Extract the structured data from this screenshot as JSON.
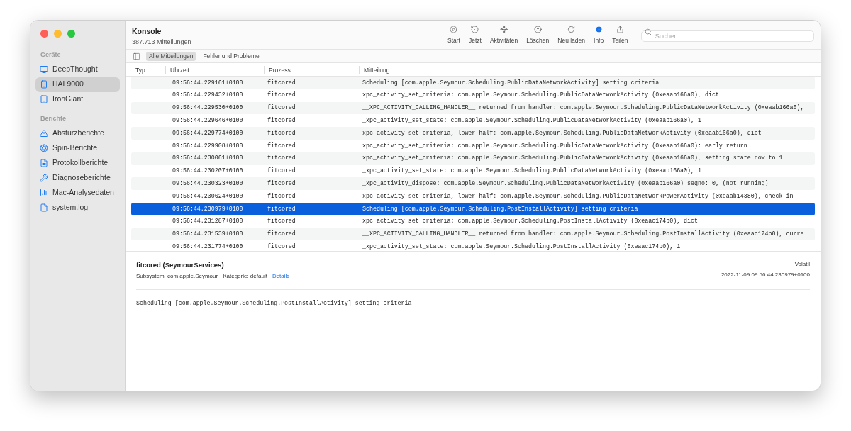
{
  "window": {
    "title": "Konsole",
    "subtitle": "387.713 Mitteilungen"
  },
  "sidebar": {
    "sections": [
      {
        "heading": "Geräte",
        "items": [
          {
            "label": "DeepThought",
            "kind": "monitor",
            "selected": false
          },
          {
            "label": "HAL9000",
            "kind": "phone",
            "selected": true
          },
          {
            "label": "IronGiant",
            "kind": "tablet",
            "selected": false
          }
        ]
      },
      {
        "heading": "Berichte",
        "items": [
          {
            "label": "Absturzberichte",
            "kind": "warning",
            "selected": false
          },
          {
            "label": "Spin-Berichte",
            "kind": "spin",
            "selected": false
          },
          {
            "label": "Protokollberichte",
            "kind": "report",
            "selected": false
          },
          {
            "label": "Diagnoseberichte",
            "kind": "tools",
            "selected": false
          },
          {
            "label": "Mac-Analysedaten",
            "kind": "chart",
            "selected": false
          },
          {
            "label": "system.log",
            "kind": "file",
            "selected": false
          }
        ]
      }
    ]
  },
  "toolbar": [
    {
      "label": "Start",
      "kind": "start",
      "selected": false
    },
    {
      "label": "Jetzt",
      "kind": "now",
      "selected": false
    },
    {
      "label": "Aktivitäten",
      "kind": "activities",
      "selected": false
    },
    {
      "label": "Löschen",
      "kind": "clear",
      "selected": false
    },
    {
      "label": "Neu laden",
      "kind": "reload",
      "selected": false
    },
    {
      "label": "Info",
      "kind": "info",
      "selected": true
    },
    {
      "label": "Teilen",
      "kind": "share",
      "selected": false
    }
  ],
  "search": {
    "placeholder": "Suchen"
  },
  "filters": [
    {
      "label": "Alle Mitteilungen",
      "selected": true
    },
    {
      "label": "Fehler und Probleme",
      "selected": false
    }
  ],
  "table": {
    "columns": [
      "Typ",
      "Uhrzeit",
      "Prozess",
      "Mitteilung"
    ],
    "rows": [
      {
        "time": "09:56:44.229161+0100",
        "process": "fitcored",
        "message": "Scheduling [com.apple.Seymour.Scheduling.PublicDataNetworkActivity] setting criteria",
        "selected": false
      },
      {
        "time": "09:56:44.229432+0100",
        "process": "fitcored",
        "message": "xpc_activity_set_criteria: com.apple.Seymour.Scheduling.PublicDataNetworkActivity (0xeaab166a0), dict",
        "selected": false
      },
      {
        "time": "09:56:44.229530+0100",
        "process": "fitcored",
        "message": "__XPC_ACTIVITY_CALLING_HANDLER__ returned from handler: com.apple.Seymour.Scheduling.PublicDataNetworkActivity (0xeaab166a0),",
        "selected": false
      },
      {
        "time": "09:56:44.229646+0100",
        "process": "fitcored",
        "message": "_xpc_activity_set_state: com.apple.Seymour.Scheduling.PublicDataNetworkActivity (0xeaab166a0), 1",
        "selected": false
      },
      {
        "time": "09:56:44.229774+0100",
        "process": "fitcored",
        "message": "xpc_activity_set_criteria, lower half: com.apple.Seymour.Scheduling.PublicDataNetworkActivity (0xeaab166a0), dict",
        "selected": false
      },
      {
        "time": "09:56:44.229908+0100",
        "process": "fitcored",
        "message": "xpc_activity_set_criteria: com.apple.Seymour.Scheduling.PublicDataNetworkActivity (0xeaab166a0): early return",
        "selected": false
      },
      {
        "time": "09:56:44.230061+0100",
        "process": "fitcored",
        "message": "xpc_activity_set_criteria: com.apple.Seymour.Scheduling.PublicDataNetworkActivity (0xeaab166a0), setting state now to 1",
        "selected": false
      },
      {
        "time": "09:56:44.230207+0100",
        "process": "fitcored",
        "message": "_xpc_activity_set_state: com.apple.Seymour.Scheduling.PublicDataNetworkActivity (0xeaab166a0), 1",
        "selected": false
      },
      {
        "time": "09:56:44.230323+0100",
        "process": "fitcored",
        "message": "_xpc_activity_dispose: com.apple.Seymour.Scheduling.PublicDataNetworkActivity (0xeaab166a0) seqno: 0, (not running)",
        "selected": false
      },
      {
        "time": "09:56:44.230624+0100",
        "process": "fitcored",
        "message": "xpc_activity_set_criteria, lower half: com.apple.Seymour.Scheduling.PublicDataNetworkPowerActivity (0xeaab14380), check-in",
        "selected": false
      },
      {
        "time": "09:56:44.230979+0100",
        "process": "fitcored",
        "message": "Scheduling [com.apple.Seymour.Scheduling.PostInstallActivity] setting criteria",
        "selected": true
      },
      {
        "time": "09:56:44.231287+0100",
        "process": "fitcored",
        "message": "xpc_activity_set_criteria: com.apple.Seymour.Scheduling.PostInstallActivity (0xeaac174b0), dict",
        "selected": false
      },
      {
        "time": "09:56:44.231539+0100",
        "process": "fitcored",
        "message": "__XPC_ACTIVITY_CALLING_HANDLER__ returned from handler: com.apple.Seymour.Scheduling.PostInstallActivity (0xeaac174b0), curre",
        "selected": false
      },
      {
        "time": "09:56:44.231774+0100",
        "process": "fitcored",
        "message": "_xpc_activity_set_state: com.apple.Seymour.Scheduling.PostInstallActivity (0xeaac174b0), 1",
        "selected": false
      }
    ]
  },
  "detail": {
    "title": "fitcored (SeymourServices)",
    "subsystem": "Subsystem: com.apple.Seymour",
    "category": "Kategorie: default",
    "link": "Details",
    "badge": "Volatil",
    "timestamp": "2022-11-09 09:56:44.230979+0100",
    "message": "Scheduling [com.apple.Seymour.Scheduling.PostInstallActivity] setting criteria"
  }
}
